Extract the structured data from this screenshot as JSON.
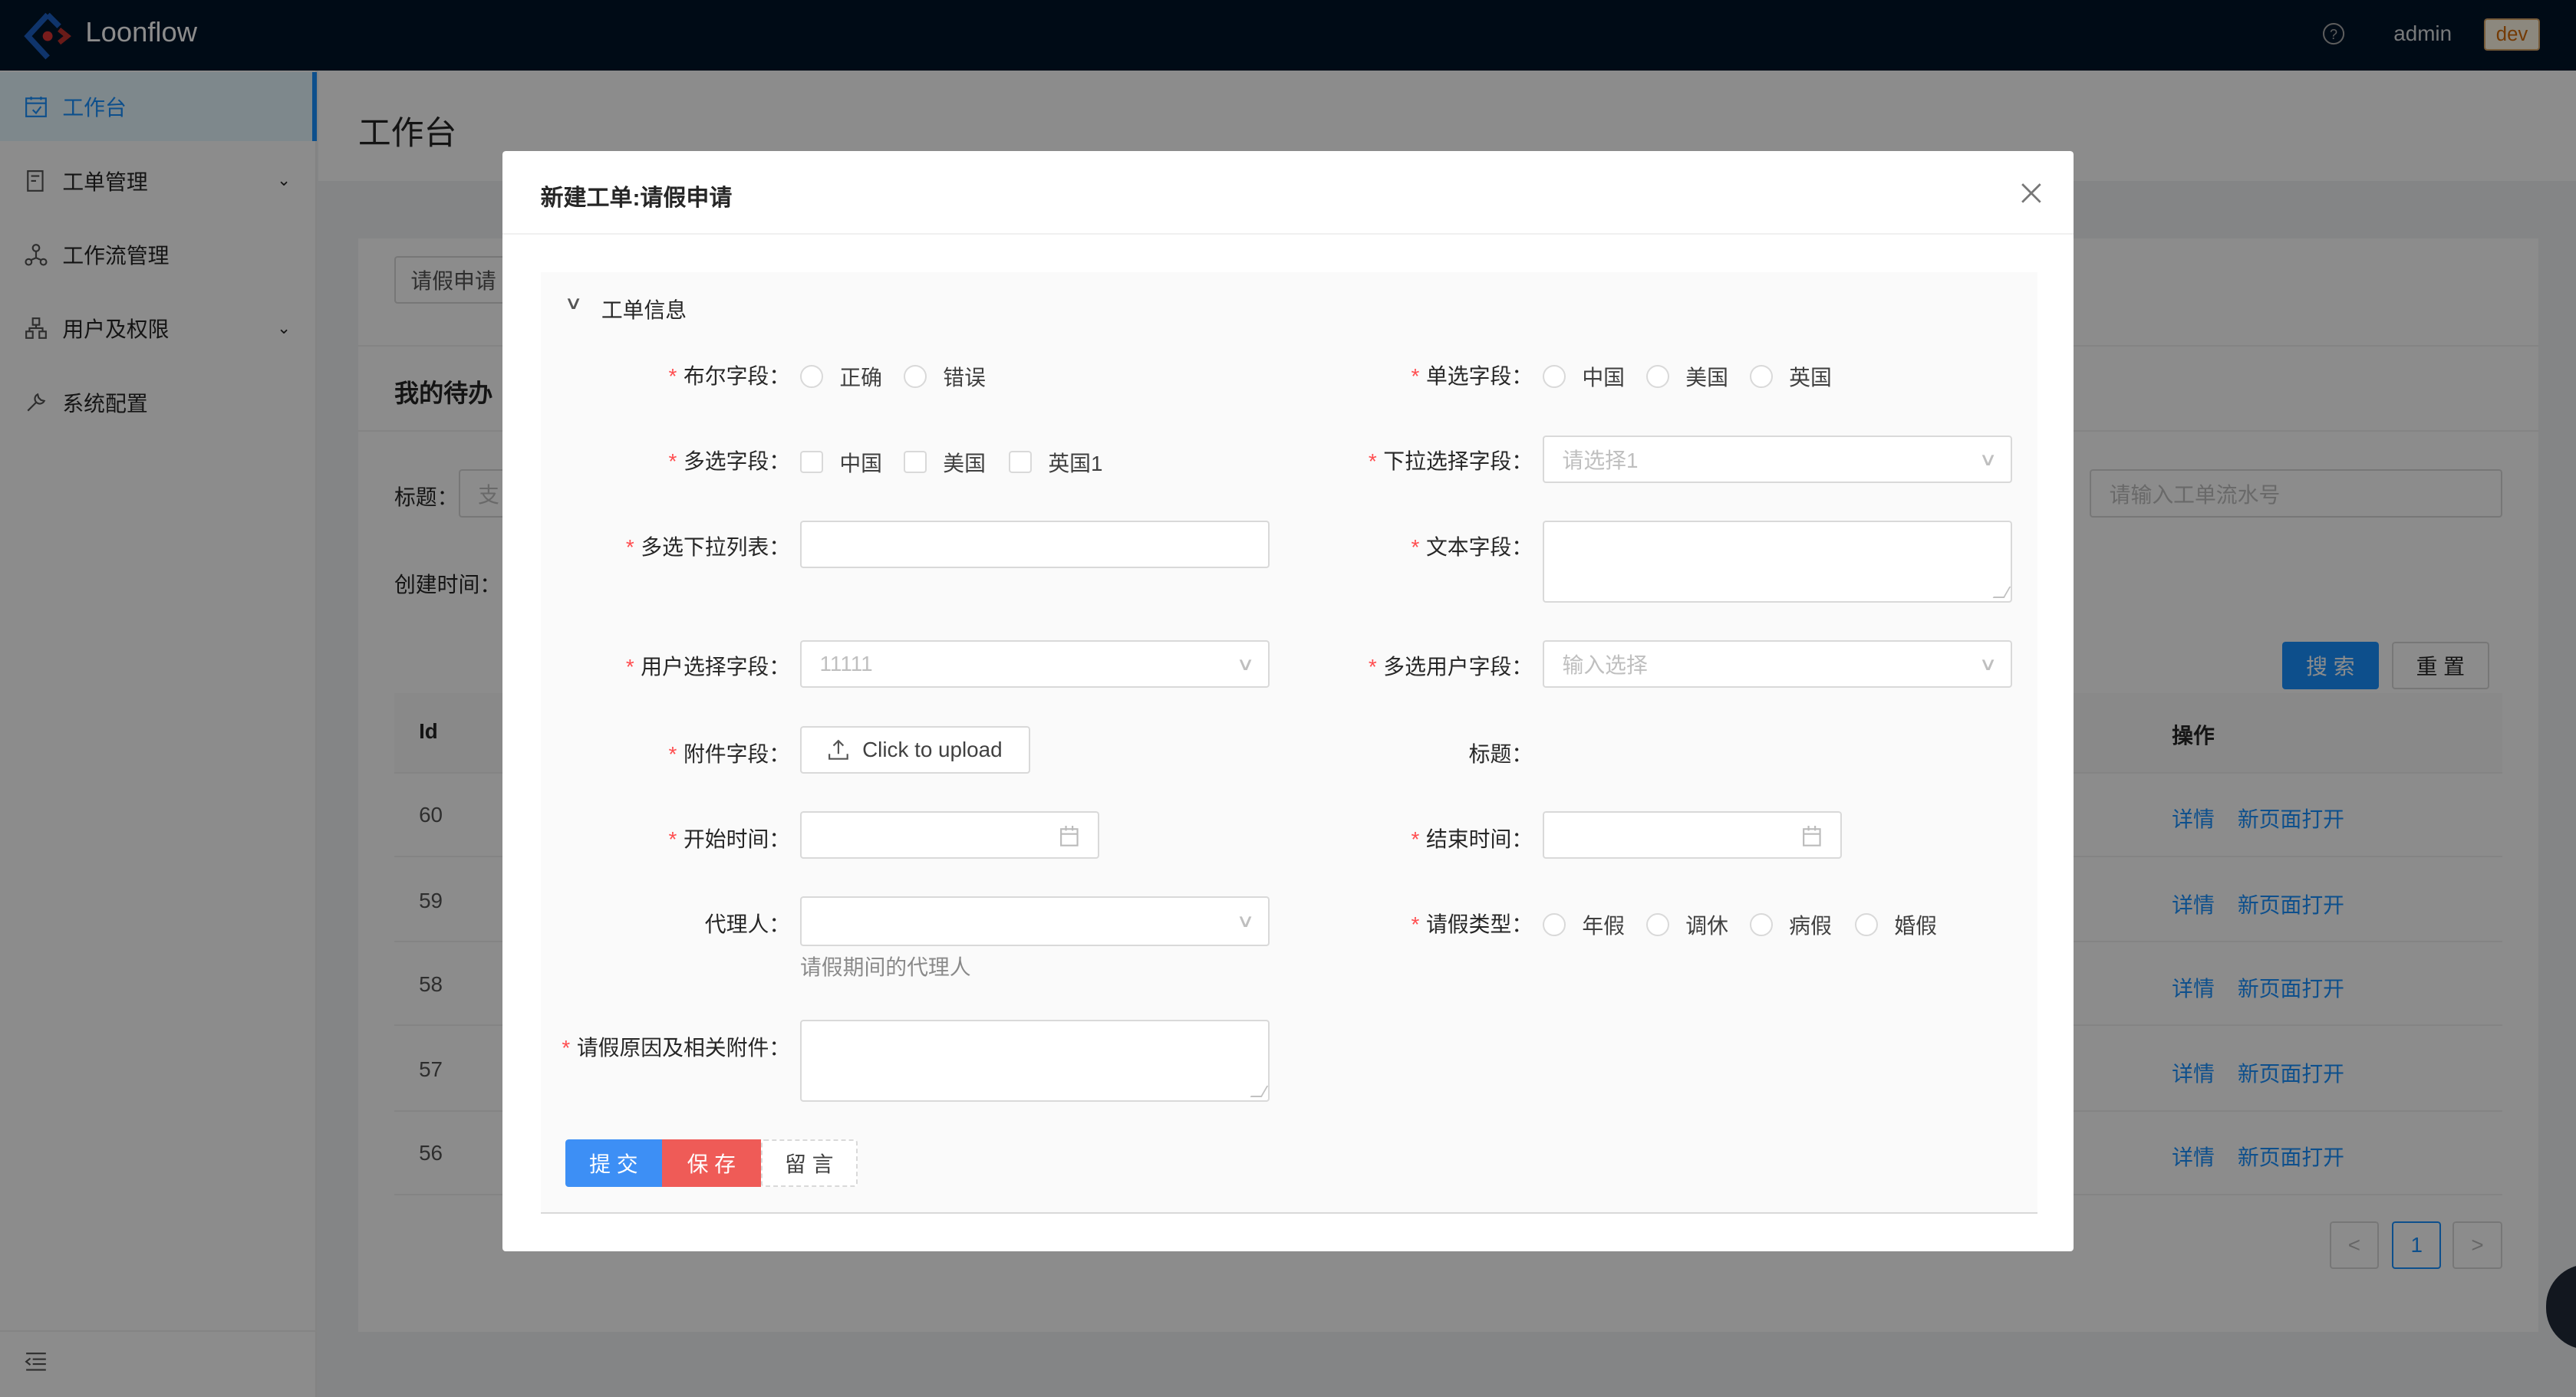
{
  "header": {
    "app_name": "Loonflow",
    "user": "admin",
    "env_tag": "dev",
    "help_icon": "question-circle-icon"
  },
  "sidebar": {
    "items": [
      {
        "label": "工作台",
        "icon": "calendar-check-icon",
        "active": true
      },
      {
        "label": "工单管理",
        "icon": "ticket-icon",
        "expandable": true
      },
      {
        "label": "工作流管理",
        "icon": "workflow-icon"
      },
      {
        "label": "用户及权限",
        "icon": "org-chart-icon",
        "expandable": true
      },
      {
        "label": "系统配置",
        "icon": "wrench-icon"
      }
    ],
    "collapse_icon": "menu-fold-icon"
  },
  "page": {
    "title": "工作台",
    "tab": "请假申请",
    "section_title": "我的待办",
    "filters": {
      "title_label": "标题：",
      "title_placeholder": "支",
      "created_label": "创建时间：",
      "sn_placeholder": "请输入工单流水号"
    },
    "search_label": "搜 索",
    "reset_label": "重 置",
    "table": {
      "columns": [
        "Id",
        "操作"
      ],
      "rows": [
        {
          "id": "60",
          "actions": [
            "详情",
            "新页面打开"
          ]
        },
        {
          "id": "59",
          "actions": [
            "详情",
            "新页面打开"
          ]
        },
        {
          "id": "58",
          "actions": [
            "详情",
            "新页面打开"
          ]
        },
        {
          "id": "57",
          "actions": [
            "详情",
            "新页面打开"
          ]
        },
        {
          "id": "56",
          "actions": [
            "详情",
            "新页面打开"
          ]
        }
      ]
    },
    "pagination": {
      "prev": "<",
      "current": "1",
      "next": ">"
    }
  },
  "modal": {
    "title": "新建工单:请假申请",
    "section": "工单信息",
    "fields": {
      "bool": {
        "label": "布尔字段：",
        "options": [
          "正确",
          "错误"
        ]
      },
      "radio": {
        "label": "单选字段：",
        "options": [
          "中国",
          "美国",
          "英国"
        ]
      },
      "multi": {
        "label": "多选字段：",
        "options": [
          "中国",
          "美国",
          "英国1"
        ]
      },
      "dropdown": {
        "label": "下拉选择字段：",
        "placeholder": "请选择1"
      },
      "multi_dropdown": {
        "label": "多选下拉列表：",
        "value": ""
      },
      "text": {
        "label": "文本字段：",
        "value": ""
      },
      "user": {
        "label": "用户选择字段：",
        "placeholder": "11111"
      },
      "multi_user": {
        "label": "多选用户字段：",
        "placeholder": "输入选择"
      },
      "attachment": {
        "label": "附件字段：",
        "button": "Click to upload"
      },
      "title": {
        "label": "标题："
      },
      "start": {
        "label": "开始时间："
      },
      "end": {
        "label": "结束时间："
      },
      "agent": {
        "label": "代理人：",
        "help": "请假期间的代理人"
      },
      "leave_type": {
        "label": "请假类型：",
        "options": [
          "年假",
          "调休",
          "病假",
          "婚假"
        ]
      },
      "reason": {
        "label": "请假原因及相关附件：",
        "value": ""
      }
    },
    "buttons": {
      "submit": "提 交",
      "save": "保 存",
      "comment": "留 言"
    },
    "colors": {
      "submit": "#3d8ff5",
      "save": "#ef5b57",
      "required": "#ff4d4f"
    }
  }
}
